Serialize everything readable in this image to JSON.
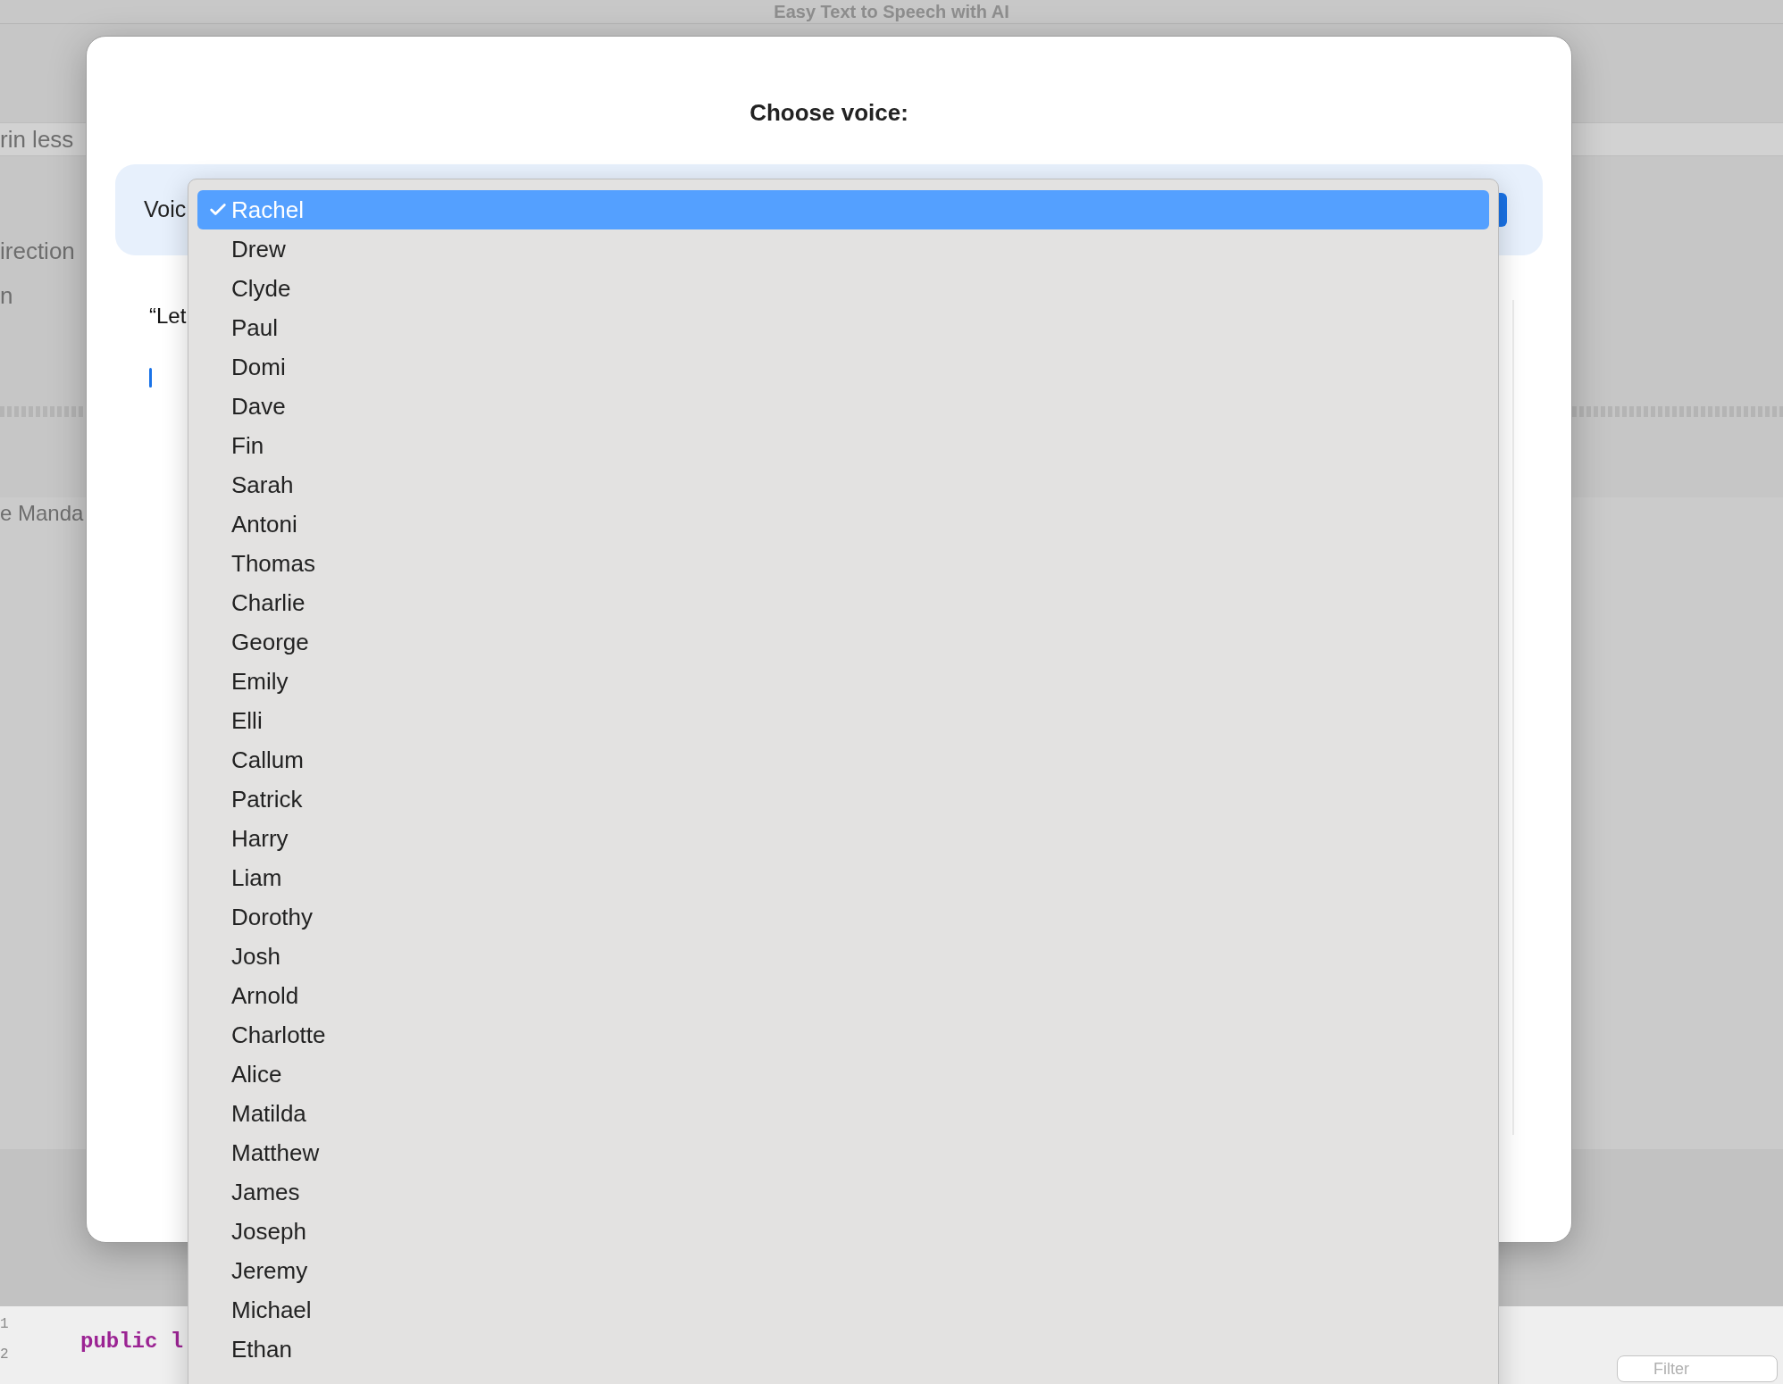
{
  "window": {
    "title": "Easy Text to Speech with AI"
  },
  "background": {
    "search_text": "rin less",
    "side_texts": [
      "irection",
      "n"
    ],
    "list_text": "e Manda",
    "line_numbers": [
      "1",
      "2"
    ],
    "code_lines": [
      "public l"
    ],
    "filter": {
      "placeholder": "Filter"
    }
  },
  "dialog": {
    "title": "Choose voice:",
    "voice_label": "Voic",
    "text_preview": "“Let",
    "voice_menu": [
      {
        "label": "Rachel",
        "selected": true
      },
      {
        "label": "Drew",
        "selected": false
      },
      {
        "label": "Clyde",
        "selected": false
      },
      {
        "label": "Paul",
        "selected": false
      },
      {
        "label": "Domi",
        "selected": false
      },
      {
        "label": "Dave",
        "selected": false
      },
      {
        "label": "Fin",
        "selected": false
      },
      {
        "label": "Sarah",
        "selected": false
      },
      {
        "label": "Antoni",
        "selected": false
      },
      {
        "label": "Thomas",
        "selected": false
      },
      {
        "label": "Charlie",
        "selected": false
      },
      {
        "label": "George",
        "selected": false
      },
      {
        "label": "Emily",
        "selected": false
      },
      {
        "label": "Elli",
        "selected": false
      },
      {
        "label": "Callum",
        "selected": false
      },
      {
        "label": "Patrick",
        "selected": false
      },
      {
        "label": "Harry",
        "selected": false
      },
      {
        "label": "Liam",
        "selected": false
      },
      {
        "label": "Dorothy",
        "selected": false
      },
      {
        "label": "Josh",
        "selected": false
      },
      {
        "label": "Arnold",
        "selected": false
      },
      {
        "label": "Charlotte",
        "selected": false
      },
      {
        "label": "Alice",
        "selected": false
      },
      {
        "label": "Matilda",
        "selected": false
      },
      {
        "label": "Matthew",
        "selected": false
      },
      {
        "label": "James",
        "selected": false
      },
      {
        "label": "Joseph",
        "selected": false
      },
      {
        "label": "Jeremy",
        "selected": false
      },
      {
        "label": "Michael",
        "selected": false
      },
      {
        "label": "Ethan",
        "selected": false
      }
    ]
  }
}
